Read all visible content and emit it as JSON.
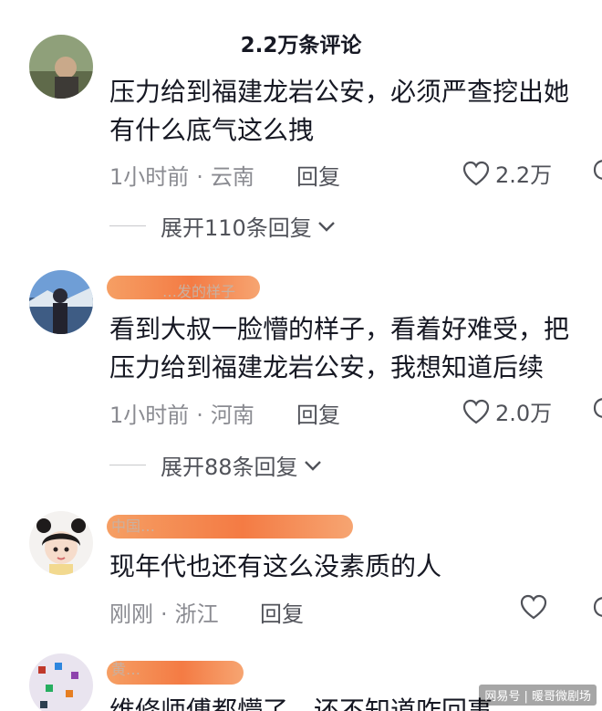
{
  "header": {
    "title": "2.2万条评论"
  },
  "comments": [
    {
      "content_lines": [
        "压力给到福建龙岩公安，必须严查挖出她",
        "有什么底气这么拽"
      ],
      "time": "1小时前",
      "location": "云南",
      "reply_label": "回复",
      "likes": "2.2万",
      "expand_label": "展开110条回复"
    },
    {
      "username": "…发的样子",
      "content_lines": [
        "看到大叔一脸懵的样子，看着好难受，把",
        "压力给到福建龙岩公安，我想知道后续"
      ],
      "time": "1小时前",
      "location": "河南",
      "reply_label": "回复",
      "likes": "2.0万",
      "expand_label": "展开88条回复"
    },
    {
      "username": "中国…",
      "content_lines": [
        "现年代也还有这么没素质的人"
      ],
      "time": "刚刚",
      "location": "浙江",
      "reply_label": "回复",
      "likes": ""
    },
    {
      "username": "黄…",
      "content_lines": [
        "维修师傅都懵了，还不知道咋回事"
      ]
    }
  ],
  "watermark": "网易号 | 暖哥微剧场",
  "colors": {
    "accent_blur": "#f3743a",
    "meta_gray": "#8a8b91",
    "text": "#161823"
  }
}
